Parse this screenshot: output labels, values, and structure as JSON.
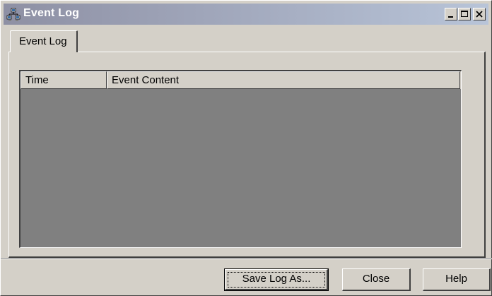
{
  "window": {
    "title": "Event Log",
    "icon": "network-computers-icon"
  },
  "title_buttons": {
    "minimize_icon": "minimize-icon",
    "maximize_icon": "maximize-icon",
    "close_icon": "close-icon"
  },
  "tabs": [
    {
      "label": "Event Log",
      "selected": true
    }
  ],
  "list": {
    "columns": [
      {
        "label": "Time"
      },
      {
        "label": "Event Content"
      }
    ],
    "rows": []
  },
  "buttons": {
    "save_label": "Save Log As...",
    "close_label": "Close",
    "help_label": "Help"
  },
  "colors": {
    "titlebar_start": "#8e90a4",
    "titlebar_end": "#b8c4d8",
    "face": "#d4d0c8",
    "list_background": "#808080"
  }
}
